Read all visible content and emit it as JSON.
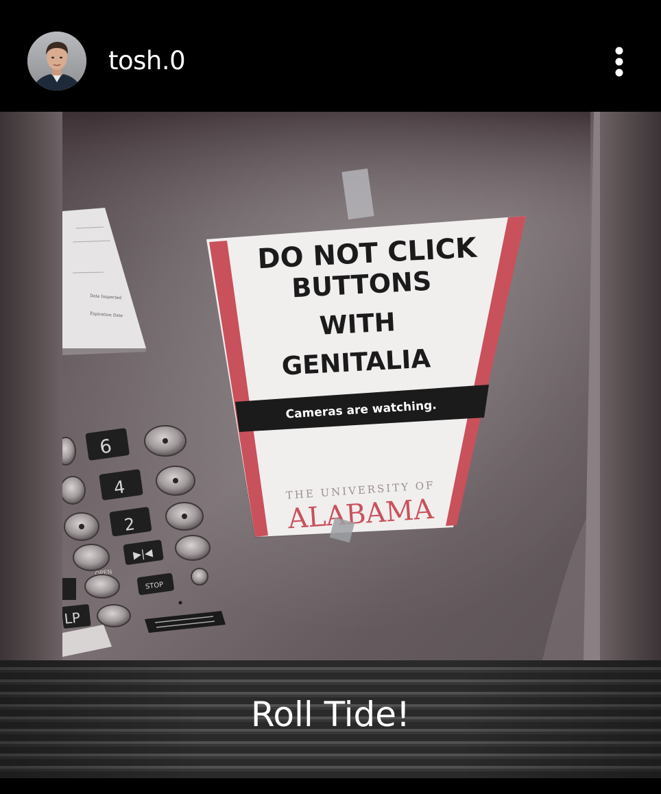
{
  "post": {
    "username": "tosh.0",
    "caption": "Roll Tide!"
  },
  "photo": {
    "sign": {
      "line1": "DO NOT CLICK",
      "line2": "BUTTONS",
      "line3": "WITH",
      "line4": "GENITALIA",
      "banner": "Cameras are watching.",
      "univ_small": "THE UNIVERSITY OF",
      "univ_big": "ALABAMA"
    },
    "certificate": {
      "label1": "Date Inspected",
      "label2": "Expiration Date"
    },
    "panel": {
      "floor6": "6",
      "floor4": "4",
      "floor2": "2",
      "door_icon": "▶|◀",
      "stop": "STOP",
      "help": "LP",
      "open_label": "OPEN"
    }
  },
  "icons": {
    "more": "more-vertical-icon",
    "avatar": "profile-avatar"
  },
  "colors": {
    "background": "#000000",
    "sign_red": "#c8515c",
    "text": "#ffffff"
  }
}
